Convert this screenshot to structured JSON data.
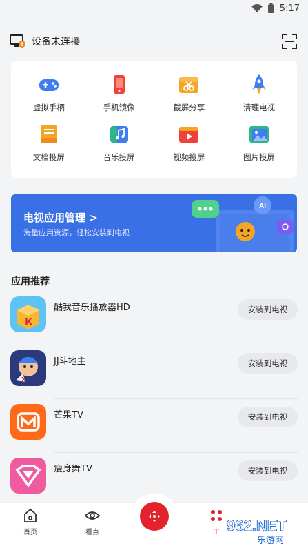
{
  "status": {
    "time": "5:17"
  },
  "device": {
    "title": "设备未连接"
  },
  "grid": [
    {
      "label": "虚拟手柄",
      "icon": "gamepad-icon"
    },
    {
      "label": "手机镜像",
      "icon": "phone-mirror-icon"
    },
    {
      "label": "截屏分享",
      "icon": "screenshot-share-icon"
    },
    {
      "label": "清理电视",
      "icon": "rocket-clean-icon"
    },
    {
      "label": "文档投屏",
      "icon": "document-cast-icon"
    },
    {
      "label": "音乐投屏",
      "icon": "music-cast-icon"
    },
    {
      "label": "视频投屏",
      "icon": "video-cast-icon"
    },
    {
      "label": "图片投屏",
      "icon": "image-cast-icon"
    }
  ],
  "banner": {
    "title": "电视应用管理 >",
    "subtitle": "海量应用资源，轻松安装到电视",
    "ai_badge": "AI",
    "color": "#3a70e6"
  },
  "section": {
    "title": "应用推荐"
  },
  "apps": [
    {
      "name": "酷我音乐播放器HD",
      "button": "安装到电视",
      "icon": "kuwo-music-icon"
    },
    {
      "name": "JJ斗地主",
      "button": "安装到电视",
      "icon": "jj-doudizhu-icon"
    },
    {
      "name": "芒果TV",
      "button": "安装到电视",
      "icon": "mango-tv-icon"
    },
    {
      "name": "瘦身舞TV",
      "button": "安装到电视",
      "icon": "slim-dance-icon"
    }
  ],
  "nav": {
    "home": "首页",
    "watch": "看点",
    "tools": "工",
    "accent": "#e2232d"
  },
  "watermark": {
    "text": "962.NET",
    "sub": "乐游网"
  }
}
